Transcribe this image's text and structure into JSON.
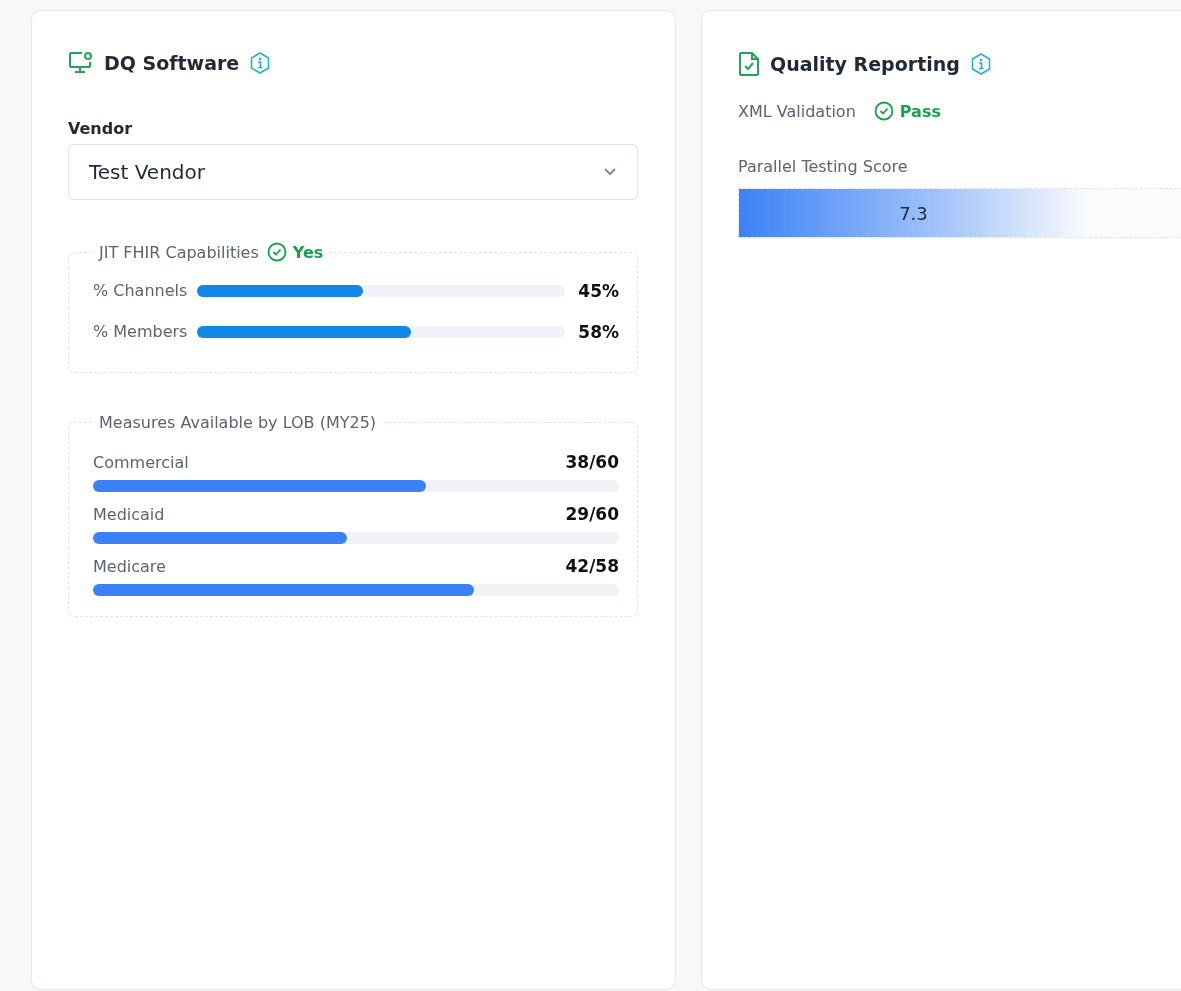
{
  "dq_software": {
    "title": "DQ Software",
    "vendor": {
      "label": "Vendor",
      "value": "Test Vendor"
    },
    "jit_fhir": {
      "title": "JIT FHIR Capabilities",
      "status": {
        "label": "Yes",
        "kind": "pass"
      },
      "metrics": [
        {
          "label": "% Channels",
          "level": 0.45,
          "reading": "45%"
        },
        {
          "label": "% Members",
          "level": 0.58,
          "reading": "58%"
        }
      ]
    },
    "measures": {
      "title": "Measures Available by LOB (MY25)",
      "rows": [
        {
          "label": "Commercial",
          "level": 0.633,
          "reading": "38/60"
        },
        {
          "label": "Medicaid",
          "level": 0.483,
          "reading": "29/60"
        },
        {
          "label": "Medicare",
          "level": 0.724,
          "reading": "42/58"
        }
      ]
    }
  },
  "quality_reporting": {
    "title": "Quality Reporting",
    "xml_validation": {
      "label": "XML Validation",
      "status": {
        "label": "Pass",
        "kind": "pass"
      }
    },
    "parallel_testing": {
      "label": "Parallel Testing Score",
      "level": 0.73,
      "reading": "7.3"
    }
  }
}
